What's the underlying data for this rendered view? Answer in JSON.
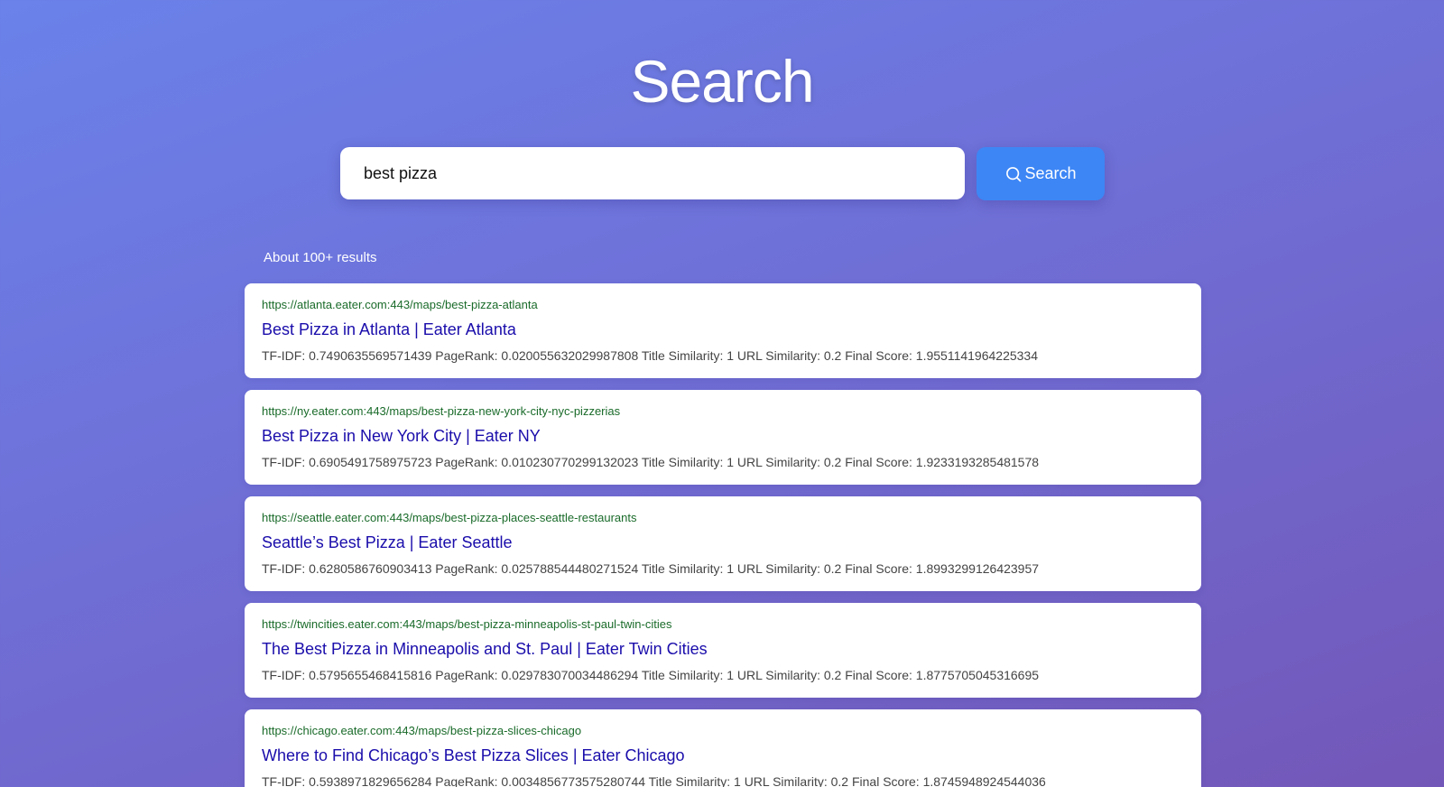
{
  "header": {
    "title": "Search"
  },
  "search": {
    "query": "best pizza",
    "button_label": "Search"
  },
  "results_summary": "About 100+ results",
  "results": [
    {
      "url": "https://atlanta.eater.com:443/maps/best-pizza-atlanta",
      "title": "Best Pizza in Atlanta | Eater Atlanta",
      "scores": "TF-IDF: 0.7490635569571439 PageRank: 0.020055632029987808 Title Similarity: 1 URL Similarity: 0.2 Final Score: 1.9551141964225334"
    },
    {
      "url": "https://ny.eater.com:443/maps/best-pizza-new-york-city-nyc-pizzerias",
      "title": "Best Pizza in New York City | Eater NY",
      "scores": "TF-IDF: 0.6905491758975723 PageRank: 0.010230770299132023 Title Similarity: 1 URL Similarity: 0.2 Final Score: 1.9233193285481578"
    },
    {
      "url": "https://seattle.eater.com:443/maps/best-pizza-places-seattle-restaurants",
      "title": "Seattle’s Best Pizza | Eater Seattle",
      "scores": "TF-IDF: 0.6280586760903413 PageRank: 0.025788544480271524 Title Similarity: 1 URL Similarity: 0.2 Final Score: 1.8993299126423957"
    },
    {
      "url": "https://twincities.eater.com:443/maps/best-pizza-minneapolis-st-paul-twin-cities",
      "title": "The Best Pizza in Minneapolis and St. Paul | Eater Twin Cities",
      "scores": "TF-IDF: 0.5795655468415816 PageRank: 0.029783070034486294 Title Similarity: 1 URL Similarity: 0.2 Final Score: 1.8775705045316695"
    },
    {
      "url": "https://chicago.eater.com:443/maps/best-pizza-slices-chicago",
      "title": "Where to Find Chicago’s Best Pizza Slices | Eater Chicago",
      "scores": "TF-IDF: 0.5938971829656284 PageRank: 0.0034856773575280744 Title Similarity: 1 URL Similarity: 0.2 Final Score: 1.8745948924544036"
    }
  ]
}
